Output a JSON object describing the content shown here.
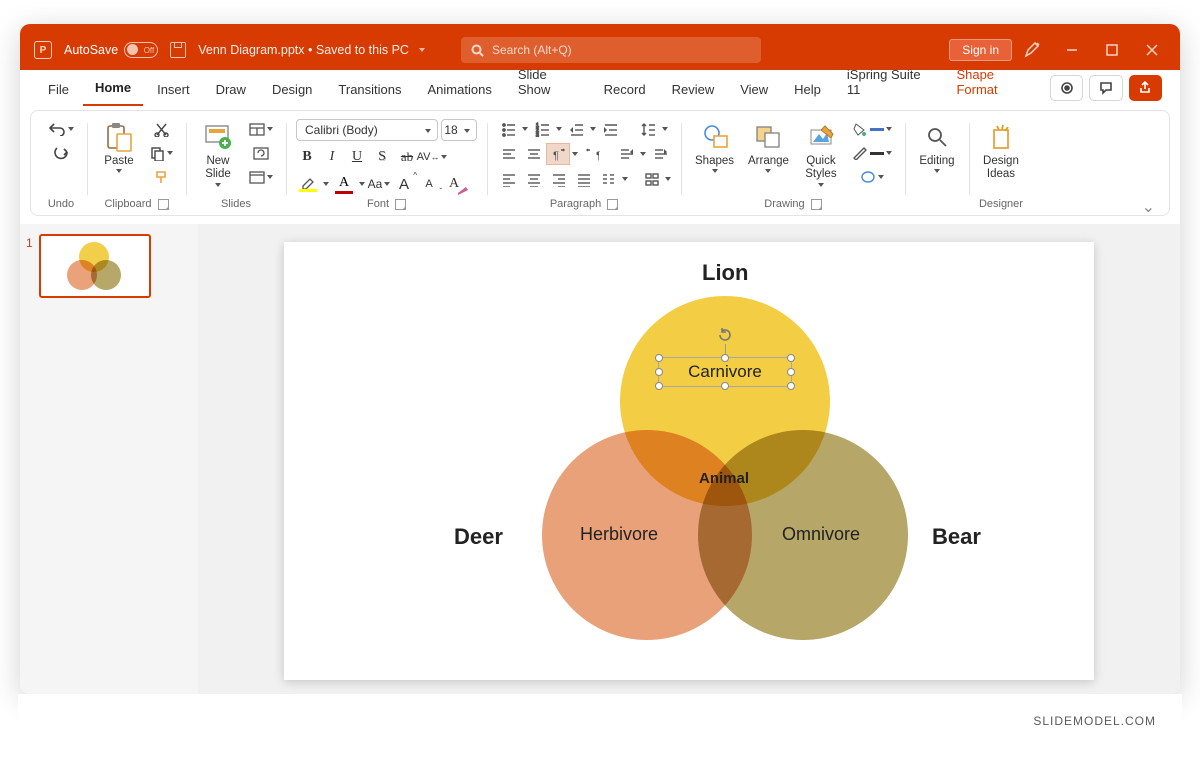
{
  "titlebar": {
    "autosave_label": "AutoSave",
    "autosave_state": "Off",
    "doc_title": "Venn Diagram.pptx • Saved to this PC",
    "search_placeholder": "Search (Alt+Q)",
    "signin": "Sign in"
  },
  "tabs": {
    "file": "File",
    "home": "Home",
    "insert": "Insert",
    "draw": "Draw",
    "design": "Design",
    "transitions": "Transitions",
    "animations": "Animations",
    "slideshow": "Slide Show",
    "record": "Record",
    "review": "Review",
    "view": "View",
    "help": "Help",
    "ispring": "iSpring Suite 11",
    "shape_format": "Shape Format"
  },
  "ribbon": {
    "undo": {
      "label": "Undo"
    },
    "clipboard": {
      "label": "Clipboard",
      "paste": "Paste"
    },
    "slides": {
      "label": "Slides",
      "new_slide": "New\nSlide"
    },
    "font": {
      "label": "Font",
      "name": "Calibri (Body)",
      "size": "18",
      "buttons": {
        "b": "B",
        "i": "I",
        "u": "U",
        "s": "S",
        "ab": "ab",
        "av": "AV",
        "aa": "Aa",
        "grow": "A",
        "shrink": "A",
        "clear": "A"
      }
    },
    "paragraph": {
      "label": "Paragraph"
    },
    "drawing": {
      "label": "Drawing",
      "shapes": "Shapes",
      "arrange": "Arrange",
      "quick_styles": "Quick\nStyles"
    },
    "editing": {
      "label": "Editing"
    },
    "designer": {
      "label": "Designer",
      "ideas": "Design\nIdeas"
    }
  },
  "thumb": {
    "num": "1"
  },
  "slide": {
    "title_top": "Lion",
    "title_left": "Deer",
    "title_right": "Bear",
    "circle_top": "Carnivore",
    "circle_left": "Herbivore",
    "circle_right": "Omnivore",
    "center": "Animal"
  },
  "watermark": "SLIDEMODEL.COM"
}
